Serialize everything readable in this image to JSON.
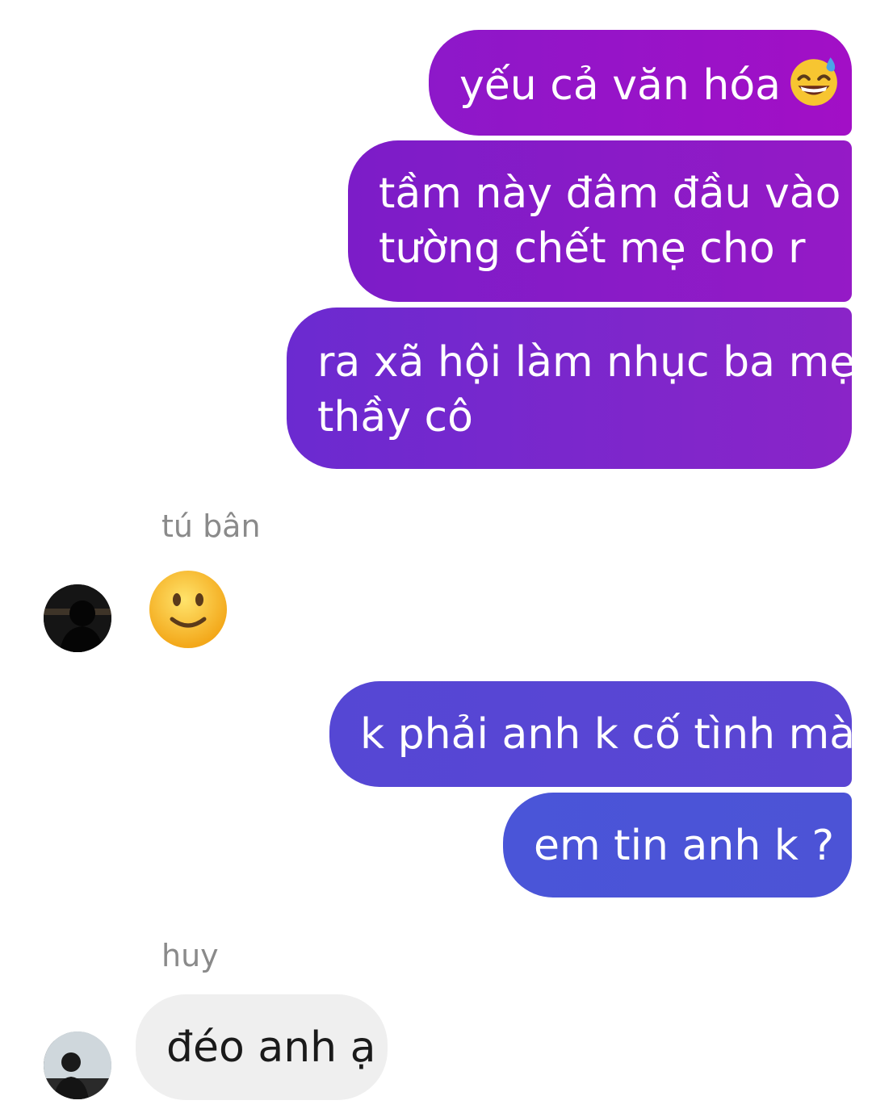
{
  "messages": [
    {
      "id": "m1",
      "direction": "outgoing",
      "text": "yếu cả văn hóa",
      "emoji": "grinning-sweat-emoji"
    },
    {
      "id": "m2",
      "direction": "outgoing",
      "line1": "tầm này đâm đầu vào",
      "line2": "tường chết mẹ cho r"
    },
    {
      "id": "m3",
      "direction": "outgoing",
      "line1": "ra xã hội làm nhục ba mẹ",
      "line2": "thầy cô"
    },
    {
      "id": "s1",
      "sender": "tú bân"
    },
    {
      "id": "e1",
      "direction": "incoming",
      "emoji": "slightly-smiling-emoji"
    },
    {
      "id": "m4",
      "direction": "outgoing",
      "text": "k phải anh k cố tình mà"
    },
    {
      "id": "m5",
      "direction": "outgoing",
      "text": "em tin anh k ?"
    },
    {
      "id": "s2",
      "sender": "huy"
    },
    {
      "id": "in1",
      "direction": "incoming",
      "text": "đéo anh ạ"
    }
  ],
  "colors": {
    "outgoing_top": "#a20fc6",
    "outgoing_bottom": "#4a55d8",
    "incoming_bg": "#efefef",
    "sender_label": "#8a8a8a",
    "background": "#ffffff"
  }
}
